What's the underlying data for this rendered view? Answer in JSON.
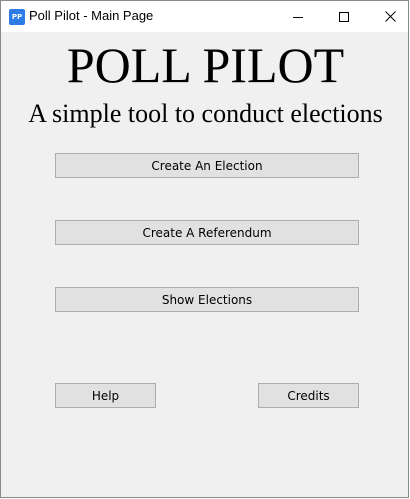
{
  "window": {
    "title": "Poll Pilot - Main Page",
    "icon_text": "PP",
    "icon_color": "#2d7be5"
  },
  "header": {
    "title": "POLL PILOT",
    "subtitle": "A simple tool to conduct elections"
  },
  "actions": {
    "create_election": "Create An Election",
    "create_referendum": "Create A Referendum",
    "show_elections": "Show Elections"
  },
  "footer": {
    "help": "Help",
    "credits": "Credits"
  },
  "icons": [
    "app-icon",
    "minimize-icon",
    "maximize-icon",
    "close-icon"
  ]
}
